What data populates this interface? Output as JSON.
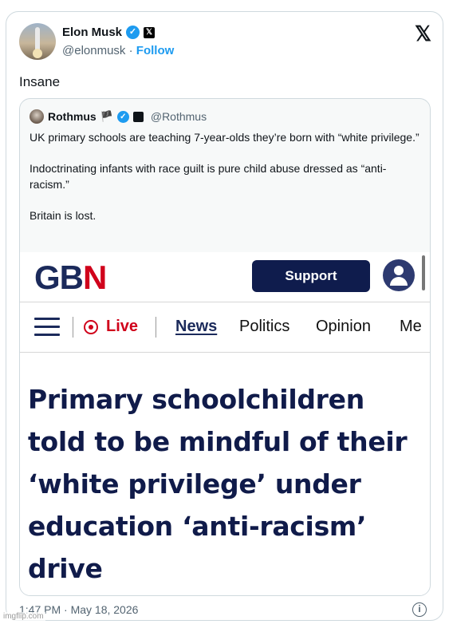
{
  "post": {
    "author_name": "Elon Musk",
    "handle": "@elonmusk",
    "separator": "·",
    "follow_label": "Follow",
    "verified_glyph": "✓",
    "affiliate_glyph": "𝕏",
    "platform_logo": "𝕏",
    "text": "Insane",
    "timestamp": "1:47 PM · May 18, 2026",
    "info_glyph": "i"
  },
  "quote": {
    "author_name": "Rothmus",
    "flag_glyph": "🏴",
    "verified_glyph": "✓",
    "handle": "@Rothmus",
    "paragraphs": [
      "UK primary schools are teaching 7-year-olds they’re born with “white privilege.”",
      "Indoctrinating infants with race guilt is pure child abuse dressed as “anti-racism.”",
      "Britain is lost."
    ]
  },
  "embedded_article": {
    "logo_left": "GB",
    "logo_right": "N",
    "support_label": "Support",
    "live_label": "Live",
    "nav_items": [
      "News",
      "Politics",
      "Opinion",
      "Me"
    ],
    "headline": "Primary schoolchildren told to be mindful of their ‘white privilege’ under education ‘anti-racism’ drive"
  },
  "watermark": "imgflip.com",
  "colors": {
    "accent_blue": "#1d9bf0",
    "gb_navy": "#1b2a5b",
    "gb_red": "#d0021b"
  },
  "icons": [
    "verified-badge-icon",
    "x-affiliate-icon",
    "x-logo-icon",
    "flag-icon",
    "user-account-icon",
    "hamburger-menu-icon",
    "live-indicator-icon",
    "info-icon"
  ]
}
